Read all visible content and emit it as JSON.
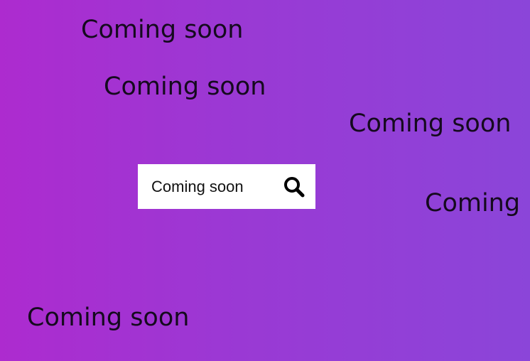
{
  "background": {
    "gradient_start": "#ad2bcf",
    "gradient_end": "#8b45d9"
  },
  "floating_labels": [
    "Coming soon",
    "Coming soon",
    "Coming soon",
    "Coming",
    "Coming soon"
  ],
  "search": {
    "value": "Coming soon",
    "icon": "search-icon"
  }
}
